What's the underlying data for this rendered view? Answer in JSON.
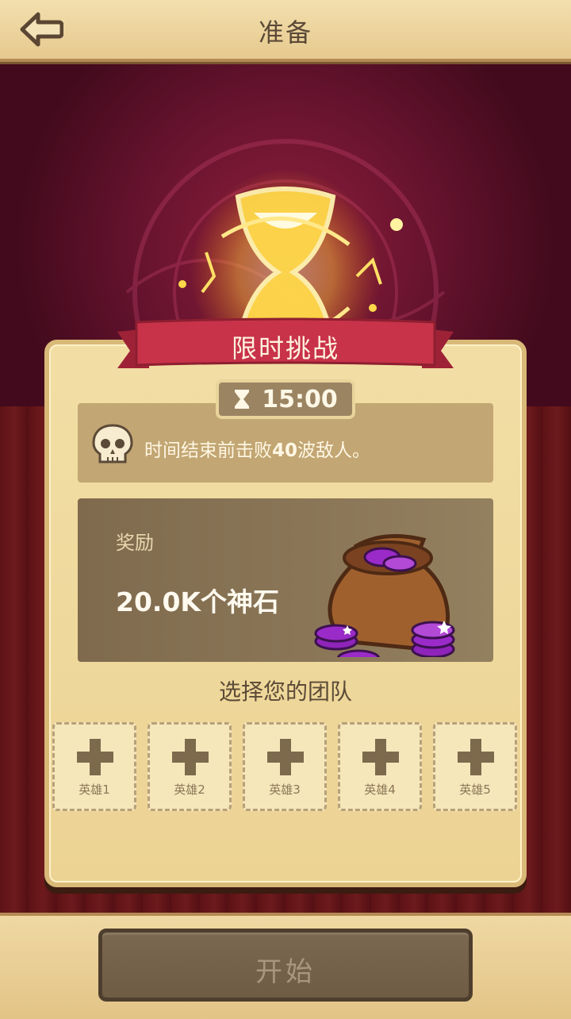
{
  "header": {
    "title": "准备"
  },
  "challenge": {
    "banner": "限时挑战",
    "timer": "15:00",
    "objective": {
      "prefix": "时间结束前击败",
      "number": "40",
      "suffix": "波敌人。"
    }
  },
  "reward": {
    "label": "奖励",
    "value": "20.0K个神石"
  },
  "team": {
    "label": "选择您的团队",
    "slots": [
      {
        "label": "英雄1"
      },
      {
        "label": "英雄2"
      },
      {
        "label": "英雄3"
      },
      {
        "label": "英雄4"
      },
      {
        "label": "英雄5"
      }
    ]
  },
  "footer": {
    "start_label": "开始"
  },
  "colors": {
    "banner_red": "#c8334a",
    "gem_purple": "#9b2bc9",
    "glow_gold": "#ffd84a"
  }
}
